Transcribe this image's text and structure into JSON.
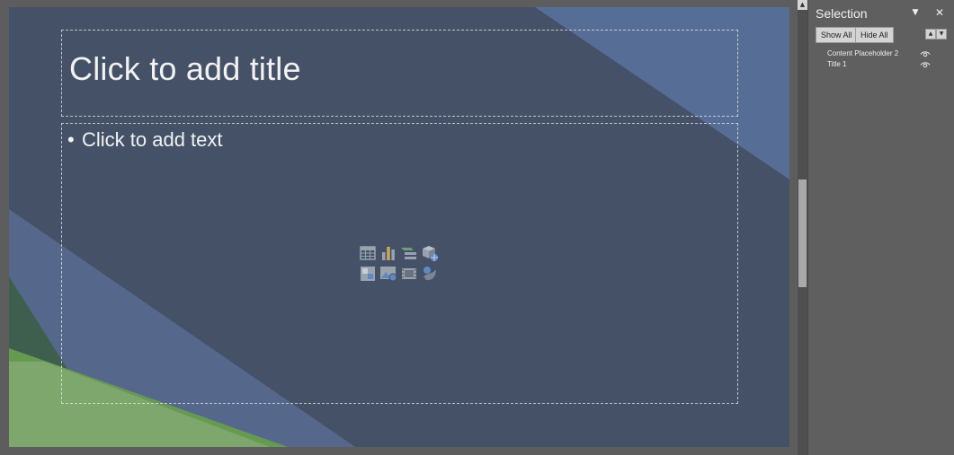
{
  "slide": {
    "title_placeholder": "Click to add title",
    "content_bullet": "•",
    "content_placeholder": "Click to add text",
    "insert_icons": [
      {
        "name": "insert-table-icon"
      },
      {
        "name": "insert-chart-icon"
      },
      {
        "name": "insert-smartart-icon"
      },
      {
        "name": "insert-3d-model-icon"
      },
      {
        "name": "insert-picture-icon"
      },
      {
        "name": "insert-online-picture-icon"
      },
      {
        "name": "insert-video-icon"
      },
      {
        "name": "insert-icons-icon"
      }
    ]
  },
  "selection_pane": {
    "title": "Selection",
    "options_icon": "▼",
    "close_icon": "✕",
    "show_all_label": "Show All",
    "hide_all_label": "Hide All",
    "bring_forward_icon": "▲",
    "send_backward_icon": "▼",
    "objects": [
      {
        "name": "Content Placeholder 2",
        "visible": true
      },
      {
        "name": "Title 1",
        "visible": true
      }
    ]
  },
  "scrollbar": {
    "up_arrow_icon": "▲"
  },
  "colors": {
    "slide_background": "#445167",
    "accent_blue": "#5b6f91",
    "accent_green": "#6a9a55",
    "pane_background": "#5f5f5f",
    "icon_gray": "#9aa2ae",
    "icon_blue": "#5d8ac3"
  }
}
